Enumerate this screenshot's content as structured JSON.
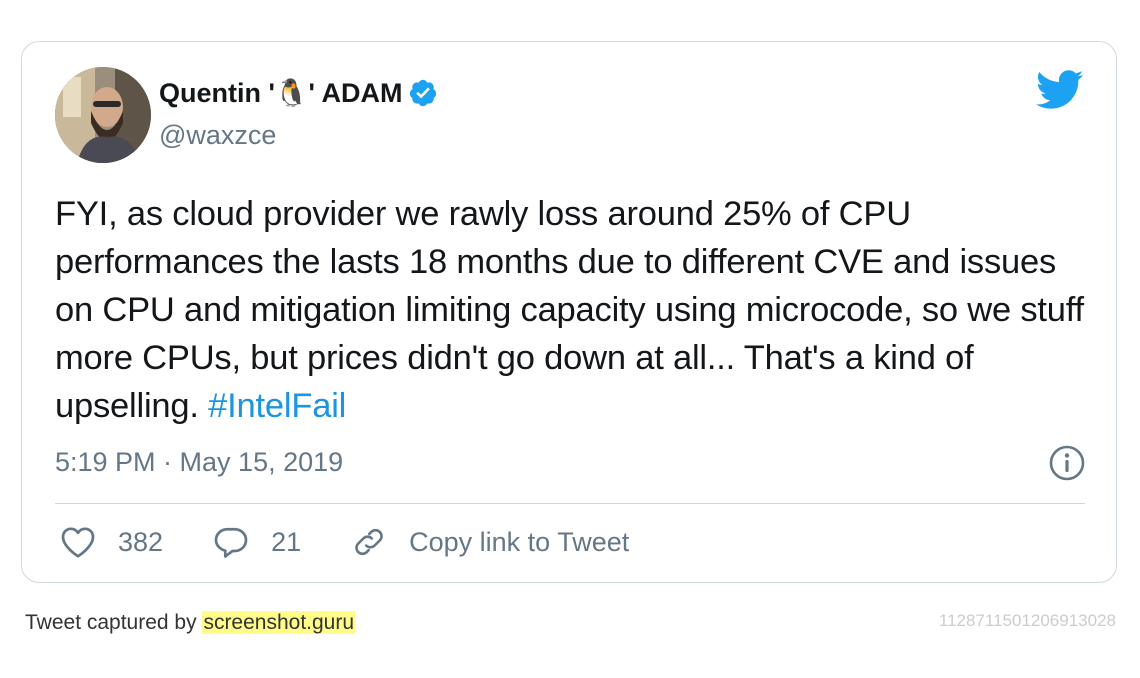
{
  "tweet": {
    "author": {
      "name_prefix": "Quentin '",
      "name_emoji": "🐧",
      "name_suffix": "' ADAM",
      "handle": "@waxzce",
      "verified": true
    },
    "text": "FYI, as cloud provider we rawly loss around 25% of CPU performances the lasts 18 months due to different CVE and issues on CPU and mitigation limiting capacity using microcode, so we stuff more CPUs, but prices didn't go down at all... That's a kind of upselling. ",
    "hashtag": "#IntelFail",
    "timestamp": "5:19 PM · May 15, 2019",
    "actions": {
      "likes": "382",
      "replies": "21",
      "copy_link": "Copy link to Tweet"
    }
  },
  "footer": {
    "captured_by": "Tweet captured by ",
    "brand": "screenshot.guru",
    "tweet_id": "1128711501206913028"
  },
  "colors": {
    "twitter_blue": "#1da1f2",
    "hashtag": "#1b95e0",
    "muted": "#657786",
    "highlight": "#fffc8a"
  },
  "icons": [
    "avatar",
    "verified-badge-icon",
    "twitter-bird-icon",
    "info-icon",
    "heart-icon",
    "reply-icon",
    "link-icon"
  ]
}
